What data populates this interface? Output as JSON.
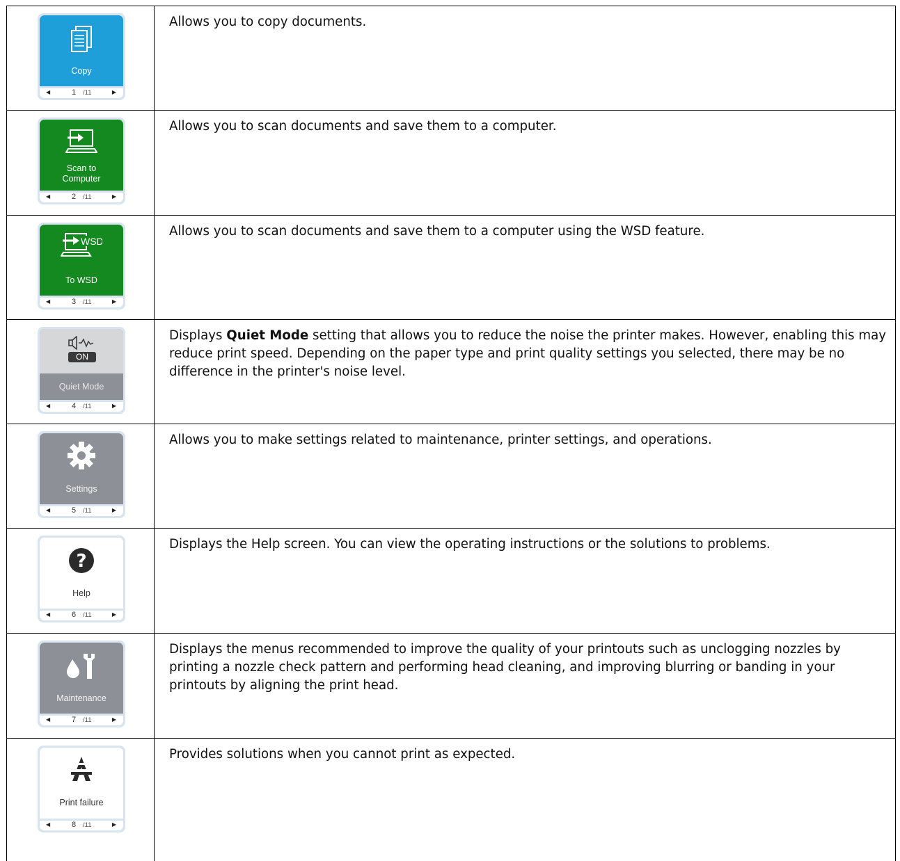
{
  "rows": [
    {
      "label": "Copy",
      "page": "1",
      "total": "/11",
      "icon": "copy-document-icon",
      "color": "#1f9fd9",
      "description": "Allows you to copy documents."
    },
    {
      "label_line1": "Scan to",
      "label_line2": "Computer",
      "page": "2",
      "total": "/11",
      "icon": "scan-to-computer-icon",
      "color": "#13891f",
      "description": "Allows you to scan documents and save them to a computer."
    },
    {
      "label": "To WSD",
      "page": "3",
      "total": "/11",
      "icon": "wsd-computer-icon",
      "icon_text": "WSD",
      "color": "#13891f",
      "description": "Allows you to scan documents and save them to a computer using the WSD feature."
    },
    {
      "label": "Quiet Mode",
      "page": "4",
      "total": "/11",
      "icon": "speaker-quiet-icon",
      "status_badge": "ON",
      "color": "#8e9098",
      "description_prefix": "Displays ",
      "description_bold": "Quiet Mode",
      "description_suffix": " setting that allows you to reduce the noise the printer makes. However, enabling this may reduce print speed. Depending on the paper type and print quality settings you selected, there may be no difference in the printer's noise level."
    },
    {
      "label": "Settings",
      "page": "5",
      "total": "/11",
      "icon": "gear-icon",
      "color": "#8e9098",
      "description": "Allows you to make settings related to maintenance, printer settings, and operations."
    },
    {
      "label": "Help",
      "page": "6",
      "total": "/11",
      "icon": "question-mark-icon",
      "color": "#ffffff",
      "description": "Displays the Help screen. You can view the operating instructions or the solutions to problems."
    },
    {
      "label": "Maintenance",
      "page": "7",
      "total": "/11",
      "icon": "ink-drop-wrench-icon",
      "color": "#8e9098",
      "description": "Displays the menus recommended to improve the quality of your printouts such as unclogging nozzles by printing a nozzle check pattern and performing head cleaning, and improving blurring or banding in your printouts by aligning the print head."
    },
    {
      "label": "Print failure",
      "page": "8",
      "total": "/11",
      "icon": "print-failure-icon",
      "color": "#ffffff",
      "description": "Provides solutions when you cannot print as expected."
    }
  ]
}
